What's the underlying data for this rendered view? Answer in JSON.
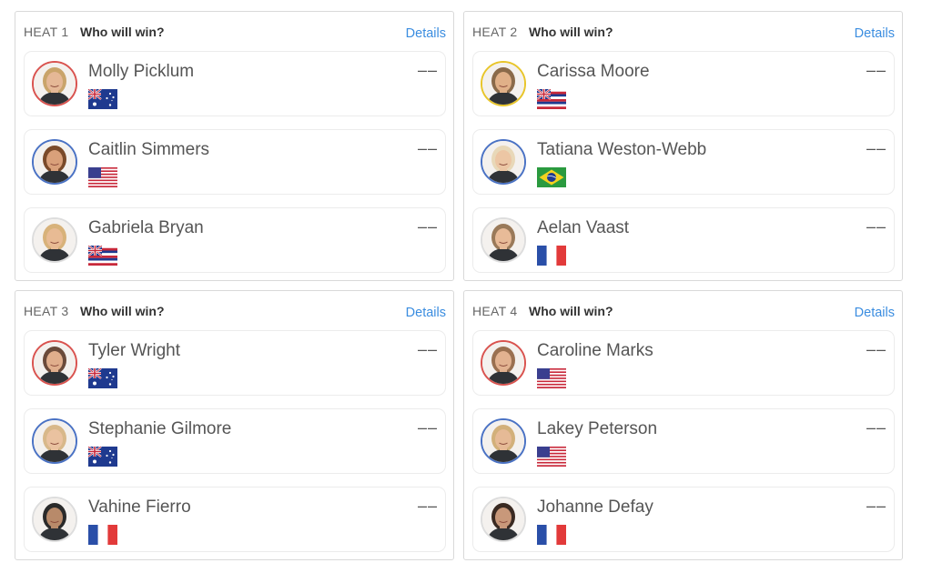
{
  "heats": [
    {
      "label": "HEAT 1",
      "question": "Who will win?",
      "details_label": "Details",
      "surfers": [
        {
          "name": "Molly Picklum",
          "score": "––",
          "flag": "AUS",
          "ring_color": "#d9534f",
          "hair": "#c9a46a",
          "skin": "#e5b896"
        },
        {
          "name": "Caitlin Simmers",
          "score": "––",
          "flag": "USA",
          "ring_color": "#4a72c4",
          "hair": "#7a4a2a",
          "skin": "#d9a07a"
        },
        {
          "name": "Gabriela Bryan",
          "score": "––",
          "flag": "HAW",
          "ring_color": "#dddddd",
          "hair": "#d8b27a",
          "skin": "#e8bb94"
        }
      ]
    },
    {
      "label": "HEAT 2",
      "question": "Who will win?",
      "details_label": "Details",
      "surfers": [
        {
          "name": "Carissa Moore",
          "score": "––",
          "flag": "HAW",
          "ring_color": "#e8c52a",
          "hair": "#8a6a4a",
          "skin": "#e0b088"
        },
        {
          "name": "Tatiana Weston-Webb",
          "score": "––",
          "flag": "BRA",
          "ring_color": "#4a72c4",
          "hair": "#e8d8b8",
          "skin": "#ecc6a4"
        },
        {
          "name": "Aelan Vaast",
          "score": "––",
          "flag": "FRA",
          "ring_color": "#dddddd",
          "hair": "#9a7a5a",
          "skin": "#e8bb98"
        }
      ]
    },
    {
      "label": "HEAT 3",
      "question": "Who will win?",
      "details_label": "Details",
      "surfers": [
        {
          "name": "Tyler Wright",
          "score": "––",
          "flag": "AUS",
          "ring_color": "#d9534f",
          "hair": "#6a4a3a",
          "skin": "#e0ae8c"
        },
        {
          "name": "Stephanie Gilmore",
          "score": "––",
          "flag": "AUS",
          "ring_color": "#4a72c4",
          "hair": "#d8b88a",
          "skin": "#eac2a0"
        },
        {
          "name": "Vahine Fierro",
          "score": "––",
          "flag": "FRA",
          "ring_color": "#dddddd",
          "hair": "#2a2a2a",
          "skin": "#b88a6a"
        }
      ]
    },
    {
      "label": "HEAT 4",
      "question": "Who will win?",
      "details_label": "Details",
      "surfers": [
        {
          "name": "Caroline Marks",
          "score": "––",
          "flag": "USA",
          "ring_color": "#d9534f",
          "hair": "#9a7050",
          "skin": "#e2b290"
        },
        {
          "name": "Lakey Peterson",
          "score": "––",
          "flag": "USA",
          "ring_color": "#4a72c4",
          "hair": "#d2b07a",
          "skin": "#e6ba96"
        },
        {
          "name": "Johanne Defay",
          "score": "––",
          "flag": "FRA",
          "ring_color": "#dddddd",
          "hair": "#3a2a22",
          "skin": "#c8987a"
        }
      ]
    }
  ]
}
